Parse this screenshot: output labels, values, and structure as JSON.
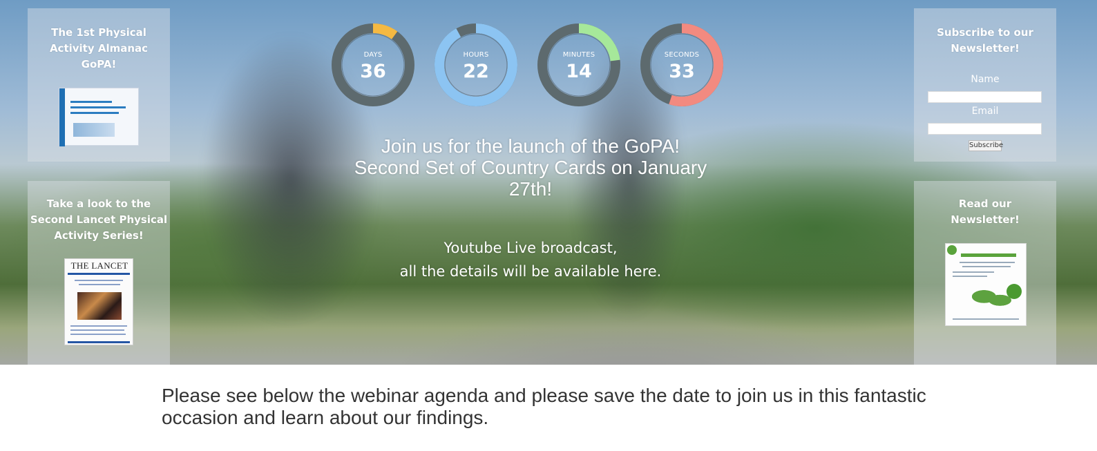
{
  "left_panels": {
    "almanac": {
      "title_lines": [
        "The 1st Physical",
        "Activity Almanac",
        "GoPA!"
      ]
    },
    "lancet": {
      "title_lines": [
        "Take a look to the",
        "Second Lancet Physical",
        "Activity Series!"
      ],
      "cover_brand": "THE LANCET"
    }
  },
  "countdown": [
    {
      "label": "DAYS",
      "value": "36",
      "fill": 0.1,
      "color": "#f5b942"
    },
    {
      "label": "HOURS",
      "value": "22",
      "fill": 0.92,
      "color": "#8cc4f2"
    },
    {
      "label": "MINUTES",
      "value": "14",
      "fill": 0.23,
      "color": "#a6e89a"
    },
    {
      "label": "SECONDS",
      "value": "33",
      "fill": 0.55,
      "color": "#f28a80"
    }
  ],
  "headline_lines": [
    "Join us for the launch of the GoPA!",
    "Second Set of Country Cards on January",
    "27th!"
  ],
  "broadcast_lines": [
    "Youtube Live broadcast,",
    "all the details will be available here."
  ],
  "subscribe": {
    "title_lines": [
      "Subscribe to our",
      "Newsletter!"
    ],
    "name_label": "Name",
    "email_label": "Email",
    "name_value": "",
    "email_value": "",
    "button_label": "Subscribe"
  },
  "newsletter": {
    "title_lines": [
      "Read our",
      "Newsletter!"
    ]
  },
  "body_text": "Please see below the webinar agenda and please save the date to join us in this fantastic occasion and learn about our findings.",
  "colors": {
    "ring_track": "#5d6a6e",
    "panel_text": "#ffffff",
    "body_text": "#333333"
  }
}
